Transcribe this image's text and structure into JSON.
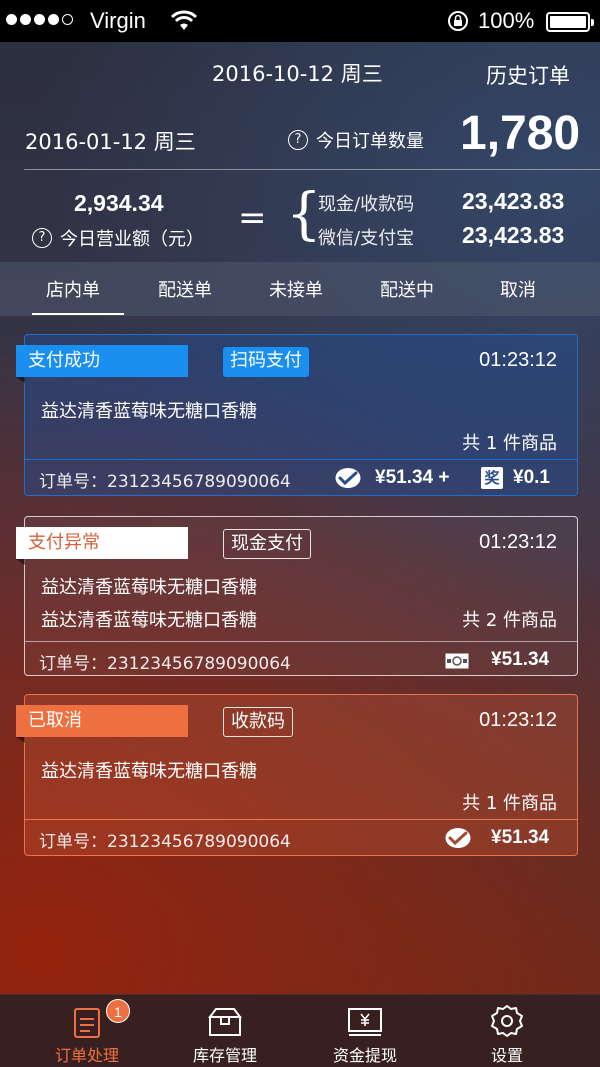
{
  "status_bar": {
    "carrier": "Virgin",
    "battery": "100%"
  },
  "header": {
    "date": "2016-10-12 周三",
    "history_link": "历史订单"
  },
  "summary": {
    "today_date": "2016-01-12 周三",
    "order_count_label": "今日订单数量",
    "order_count": "1,780",
    "revenue": "2,934.34",
    "revenue_label": "今日营业额（元）",
    "equals": "=",
    "brace": "{",
    "payments": [
      {
        "label": "现金/收款码",
        "value": "23,423.83"
      },
      {
        "label": "微信/支付宝",
        "value": "23,423.83"
      }
    ],
    "help_icon": "?"
  },
  "tabs": [
    "店内单",
    "配送单",
    "未接单",
    "配送中",
    "取消"
  ],
  "orders": [
    {
      "status": "支付成功",
      "method": "扫码支付",
      "time": "01:23:12",
      "items": [
        "益达清香蓝莓味无糖口香糖"
      ],
      "count": "共 1 件商品",
      "order_no": "订单号：23123456789090064",
      "pay_icon": "wechat-icon",
      "price": "¥51.34 +",
      "bonus_icon_text": "奖",
      "bonus": "¥0.1"
    },
    {
      "status": "支付异常",
      "method": "现金支付",
      "time": "01:23:12",
      "items": [
        "益达清香蓝莓味无糖口香糖",
        "益达清香蓝莓味无糖口香糖"
      ],
      "count": "共 2 件商品",
      "order_no": "订单号：23123456789090064",
      "pay_icon": "cash-icon",
      "price": "¥51.34"
    },
    {
      "status": "已取消",
      "method": "收款码",
      "time": "01:23:12",
      "items": [
        "益达清香蓝莓味无糖口香糖"
      ],
      "count": "共 1 件商品",
      "order_no": "订单号：23123456789090064",
      "pay_icon": "wechat-icon",
      "price": "¥51.34"
    }
  ],
  "bottom_nav": {
    "items": [
      {
        "label": "订单处理",
        "icon": "order-icon",
        "badge": "1"
      },
      {
        "label": "库存管理",
        "icon": "inventory-icon"
      },
      {
        "label": "资金提现",
        "icon": "withdraw-icon"
      },
      {
        "label": "设置",
        "icon": "gear-icon"
      }
    ]
  },
  "colors": {
    "accent_orange": "#ee7040",
    "accent_blue": "#1b8ff0"
  }
}
